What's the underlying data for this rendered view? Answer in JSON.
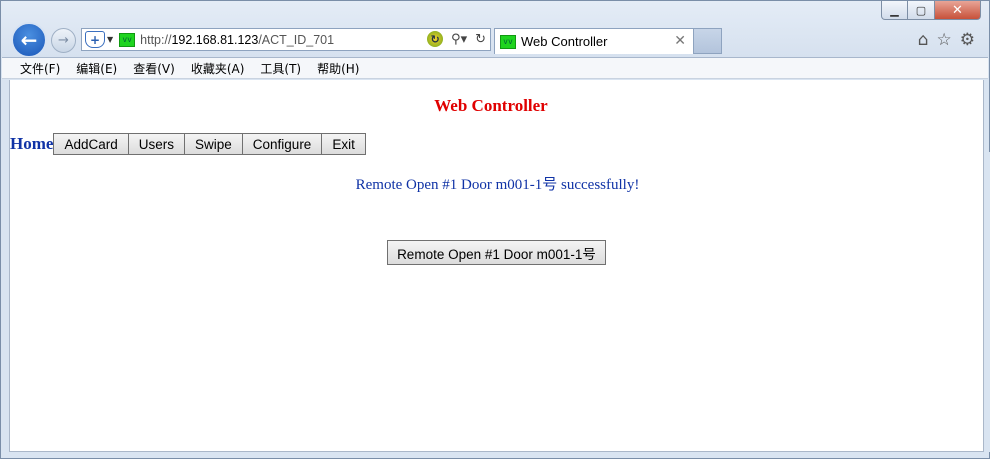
{
  "browser": {
    "address": {
      "scheme": "http://",
      "host": "192.168.81.123",
      "path": "/ACT_ID_701"
    },
    "tab": {
      "title": "Web Controller"
    },
    "menu": [
      "文件(F)",
      "编辑(E)",
      "查看(V)",
      "收藏夹(A)",
      "工具(T)",
      "帮助(H)"
    ]
  },
  "page": {
    "title": "Web Controller",
    "home_label": "Home",
    "nav_buttons": [
      "AddCard",
      "Users",
      "Swipe",
      "Configure",
      "Exit"
    ],
    "status_message": "Remote Open #1 Door m001-1号 successfully!",
    "action_button": "Remote Open #1 Door m001-1号"
  },
  "colors": {
    "title_red": "#e00000",
    "link_blue": "#1033a6"
  }
}
